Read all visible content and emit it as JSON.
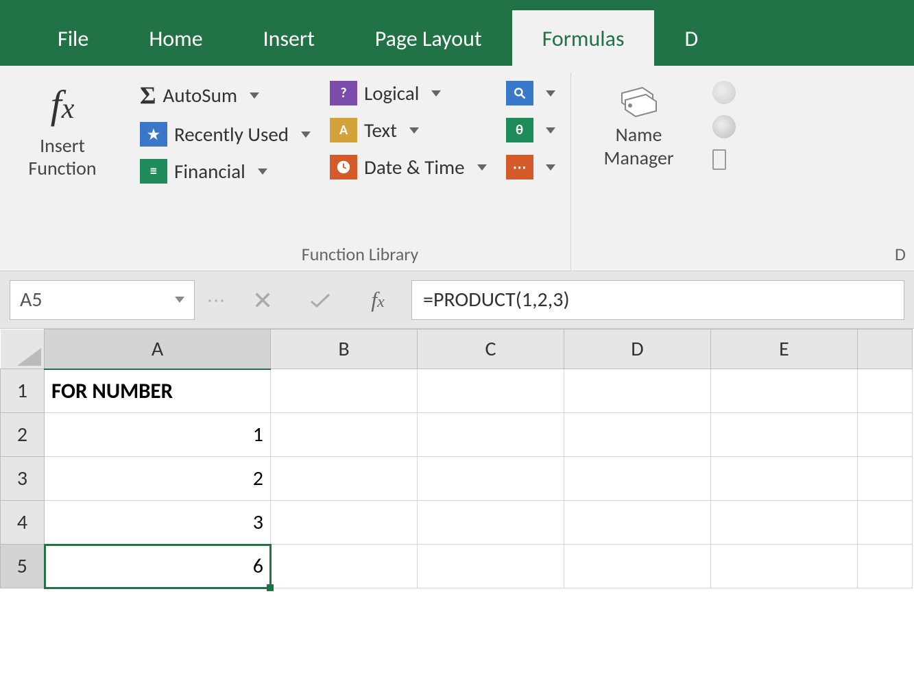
{
  "tabs": {
    "file": "File",
    "home": "Home",
    "insert": "Insert",
    "page_layout": "Page Layout",
    "formulas": "Formulas",
    "data_partial": "D"
  },
  "ribbon": {
    "insert_function": {
      "line1": "Insert",
      "line2": "Function"
    },
    "autosum": "AutoSum",
    "recently_used": "Recently Used",
    "financial": "Financial",
    "logical": "Logical",
    "text": "Text",
    "date_time": "Date & Time",
    "group_label": "Function Library",
    "name_manager": {
      "line1": "Name",
      "line2": "Manager"
    },
    "defined_names_partial": "D"
  },
  "formula_bar": {
    "namebox": "A5",
    "formula": "=PRODUCT(1,2,3)"
  },
  "sheet": {
    "columns": [
      "A",
      "B",
      "C",
      "D",
      "E"
    ],
    "active_col": "A",
    "active_row": "5",
    "rows": [
      {
        "num": "1",
        "A": "FOR NUMBER",
        "header": true
      },
      {
        "num": "2",
        "A": "1"
      },
      {
        "num": "3",
        "A": "2"
      },
      {
        "num": "4",
        "A": "3"
      },
      {
        "num": "5",
        "A": "6",
        "selected": true
      }
    ]
  }
}
